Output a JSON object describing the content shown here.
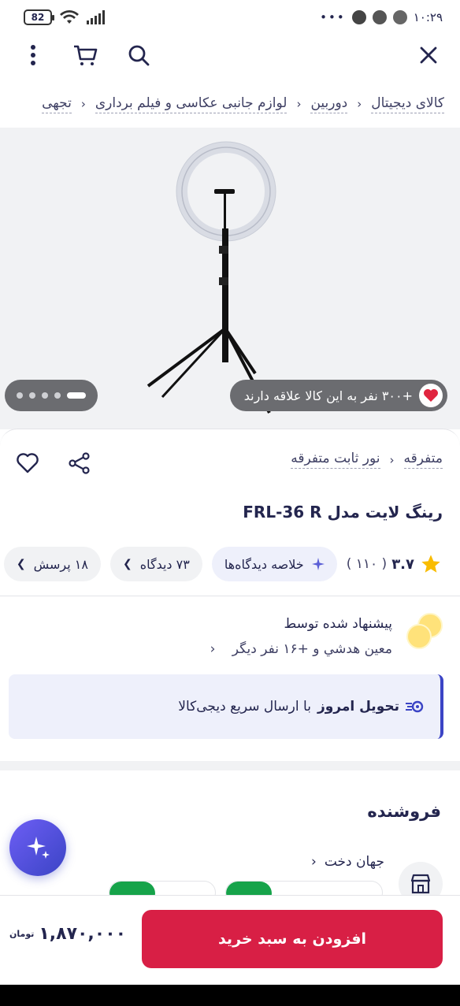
{
  "status_bar": {
    "battery": "82",
    "time": "۱۰:۲۹"
  },
  "toolbar": {
    "close_icon": "close-icon",
    "search_icon": "search-icon",
    "cart_icon": "cart-icon",
    "more_icon": "more-vertical-icon"
  },
  "breadcrumb": [
    "کالای دیجیتال",
    "دوربین",
    "لوازم جانبی عکاسی و فیلم برداری",
    "تجهی"
  ],
  "gallery": {
    "interest_text": "+۳۰۰ نفر به این کالا علاقه دارند",
    "dots": 5,
    "active_dot": 0
  },
  "product": {
    "categories": [
      "متفرقه",
      "نور ثابت متفرقه"
    ],
    "title": "رینگ لایت مدل FRL-36 R",
    "rating": "۳.۷",
    "rating_count": "( ۱۱۰ )",
    "summary_label": "خلاصه دیدگاه‌ها",
    "comments_label": "۷۳ دیدگاه",
    "questions_label": "۱۸ پرسش"
  },
  "suggestion": {
    "line1": "پیشنهاد شده توسط",
    "line2": "معین هدشي و +۱۶ نفر دیگر"
  },
  "delivery": {
    "bold": "تحویل امروز",
    "rest": "با ارسال سریع دیجی‌کالا"
  },
  "seller": {
    "title": "فروشنده",
    "name": "جهان دخت"
  },
  "bottom": {
    "add_to_cart": "افزودن به سبد خرید",
    "price": "۱,۸۷۰,۰۰۰",
    "currency": "تومان"
  },
  "colors": {
    "primary": "#d81f45",
    "accent_blue": "#3b44c5",
    "text": "#23254e"
  }
}
